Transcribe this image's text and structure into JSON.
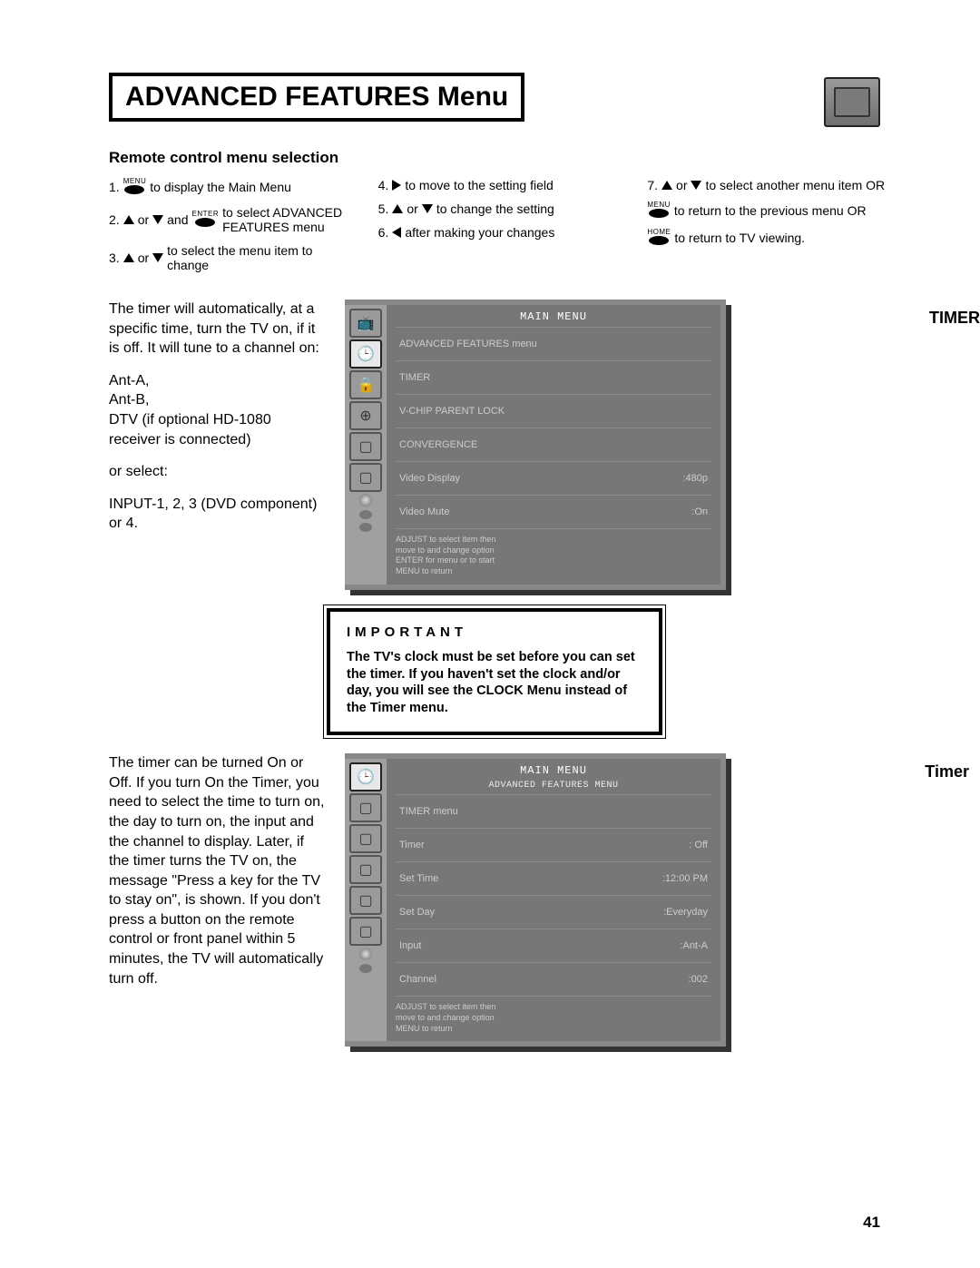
{
  "page_title": "ADVANCED FEATURES Menu",
  "section_subhead": "Remote control menu selection",
  "instructions": {
    "col1": {
      "i1a": "1.",
      "btn_menu": "MENU",
      "i1b": "to display the Main Menu",
      "i2a": "2.",
      "i2b": "or",
      "btn_enter": "ENTER",
      "i2c": "and",
      "i2d": "to select ADVANCED FEATURES menu",
      "i3a": "3.",
      "i3b": "or",
      "i3c": "to select the menu item to change"
    },
    "col2": {
      "i4a": "4.",
      "i4b": "to move to the setting field",
      "i5a": "5.",
      "i5b": "or",
      "i5c": "to change the setting",
      "i6a": "6.",
      "i6b": "after making your changes"
    },
    "col3": {
      "i7a": "7.",
      "i7b": "or",
      "i7c": "to select another menu item OR",
      "btn_menu2": "MENU",
      "i8": "to return to the previous menu OR",
      "btn_home": "HOME",
      "i9": "to return to TV viewing."
    }
  },
  "timer_label": "TIMER",
  "timer_desc": {
    "p1": "The timer will automatically, at a specific time, turn the TV on, if it is off.  It will tune to a channel on:",
    "p2": "Ant-A,\nAnt-B,\nDTV (if optional HD-1080 receiver is connected)",
    "p3": "or select:",
    "p4": "INPUT-1, 2, 3 (DVD component) or 4."
  },
  "main_menu": {
    "title": "MAIN MENU",
    "items": [
      {
        "label": "ADVANCED FEATURES menu",
        "value": ""
      },
      {
        "label": "TIMER",
        "value": ""
      },
      {
        "label": "V-CHIP PARENT LOCK",
        "value": ""
      },
      {
        "label": "CONVERGENCE",
        "value": ""
      },
      {
        "label": "Video Display",
        "value": ":480p"
      },
      {
        "label": "Video Mute",
        "value": ":On"
      }
    ],
    "hint": "ADJUST to select item then\nmove to and change option\nENTER for menu or to start\nMENU to return"
  },
  "important": {
    "title": "IMPORTANT",
    "text": "The TV's clock must be set before you can set the timer.  If you haven't set the clock and/or day, you will see the CLOCK Menu instead of the Timer menu."
  },
  "timer2_label": "Timer",
  "timer2_desc": "The timer can be turned On or Off.   If you turn On the Timer, you need to select the time to turn on, the day to turn on, the input and the channel to display.  Later, if the timer turns the TV on, the message \"Press a key for the TV to stay on\", is shown. If you don't press a button on the remote control or front panel within 5 minutes, the TV will automatically turn off.",
  "timer_menu": {
    "title": "MAIN MENU",
    "subtitle": "ADVANCED FEATURES MENU",
    "header": "TIMER menu",
    "items": [
      {
        "label": "Timer",
        "value": ": Off"
      },
      {
        "label": "Set Time",
        "value": ":12:00 PM"
      },
      {
        "label": "Set Day",
        "value": ":Everyday"
      },
      {
        "label": "Input",
        "value": ":Ant-A"
      },
      {
        "label": "Channel",
        "value": ":002"
      }
    ],
    "hint": "ADJUST to select item then\nmove to and change option\nMENU to return"
  },
  "page_number": "41"
}
